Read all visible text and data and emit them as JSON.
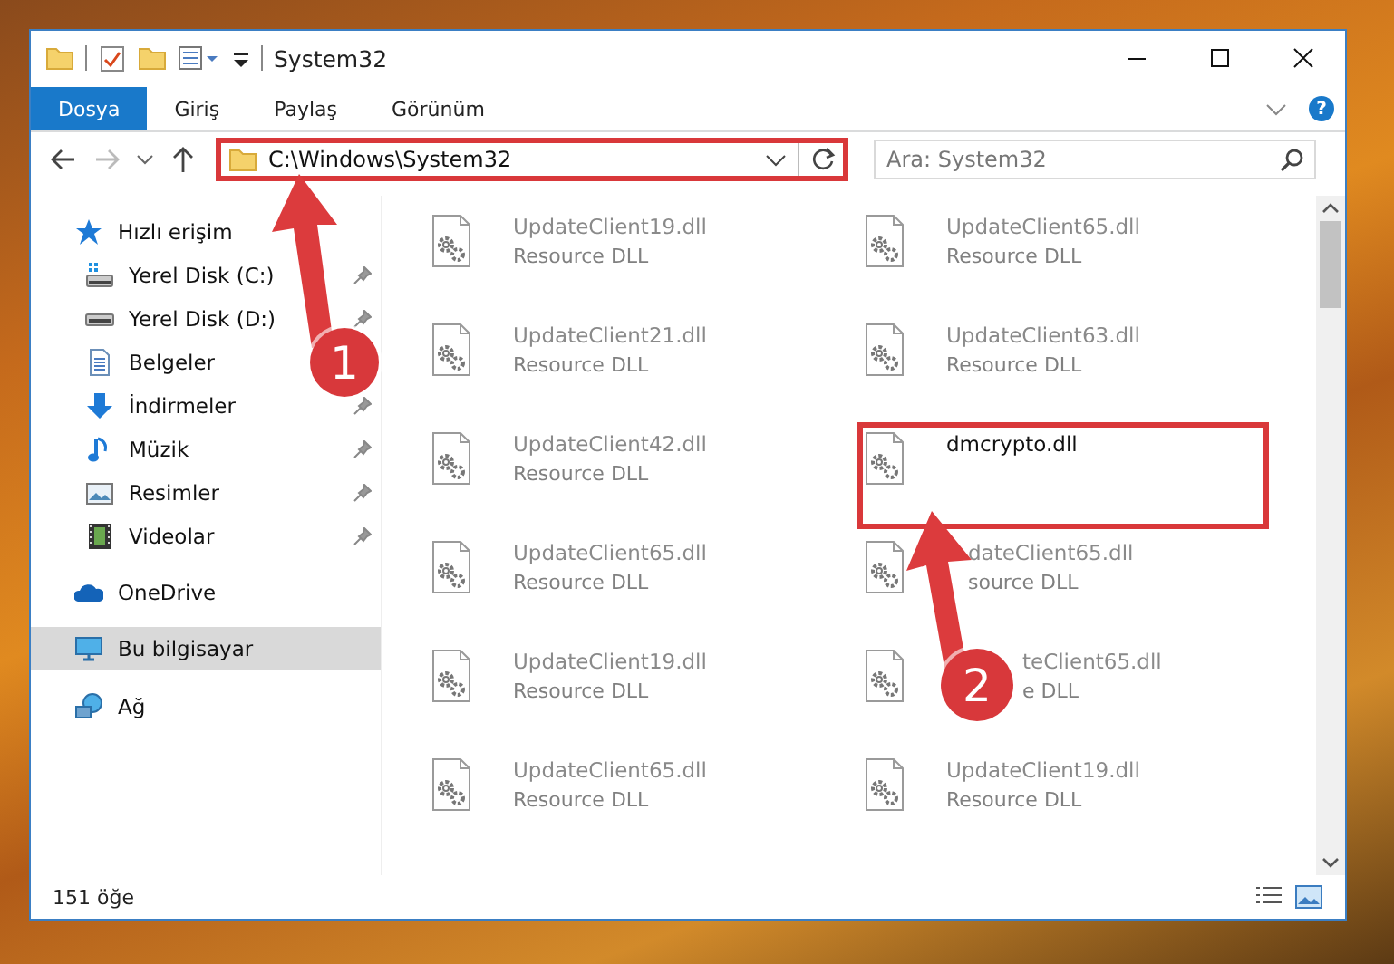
{
  "window": {
    "title": "System32"
  },
  "ribbon": {
    "tabs": [
      {
        "label": "Dosya",
        "selected": true
      },
      {
        "label": "Giriş",
        "selected": false
      },
      {
        "label": "Paylaş",
        "selected": false
      },
      {
        "label": "Görünüm",
        "selected": false
      }
    ],
    "help_label": "?"
  },
  "address_bar": {
    "path": "C:\\Windows\\System32"
  },
  "search": {
    "placeholder": "Ara: System32"
  },
  "sidebar": {
    "items": [
      {
        "label": "Hızlı erişim",
        "kind": "quick",
        "selected": false,
        "children": [
          {
            "label": "Yerel Disk (C:)",
            "kind": "drive-c",
            "pinned": true,
            "selected": false
          },
          {
            "label": "Yerel Disk (D:)",
            "kind": "drive",
            "pinned": true,
            "selected": false
          },
          {
            "label": "Belgeler",
            "kind": "documents",
            "selected": false
          },
          {
            "label": "İndirmeler",
            "kind": "downloads",
            "pinned": true,
            "selected": false
          },
          {
            "label": "Müzik",
            "kind": "music",
            "pinned": true,
            "selected": false
          },
          {
            "label": "Resimler",
            "kind": "pictures",
            "pinned": true,
            "selected": false
          },
          {
            "label": "Videolar",
            "kind": "videos",
            "pinned": true,
            "selected": false
          }
        ]
      },
      {
        "label": "OneDrive",
        "kind": "onedrive",
        "selected": false
      },
      {
        "label": "Bu bilgisayar",
        "kind": "pc",
        "selected": true
      },
      {
        "label": "Ağ",
        "kind": "network",
        "selected": false
      }
    ]
  },
  "files": [
    {
      "name": "UpdateClient19.dll",
      "type": "Resource DLL",
      "faded": true,
      "kind": "plain"
    },
    {
      "name": "UpdateClient65.dll",
      "type": "Resource DLL",
      "faded": true,
      "kind": "plain"
    },
    {
      "name": "UpdateClient21.dll",
      "type": "Resource DLL",
      "faded": true,
      "kind": "plain"
    },
    {
      "name": "UpdateClient63.dll",
      "type": "Resource DLL",
      "faded": true,
      "kind": "plain"
    },
    {
      "name": "UpdateClient42.dll",
      "type": "Resource DLL",
      "faded": true,
      "kind": "plain"
    },
    {
      "name": "dmcrypto.dll",
      "faded": false,
      "kind": "plain"
    },
    {
      "name": "UpdateClient65.dll",
      "type": "Resource DLL",
      "faded": true,
      "kind": "plain"
    },
    {
      "name": "dateClient65.dll",
      "type": "source DLL",
      "faded": true,
      "kind": "under-arrow"
    },
    {
      "name": "UpdateClient19.dll",
      "type": "Resource DLL",
      "faded": true,
      "kind": "plain"
    },
    {
      "name": "teClient65.dll",
      "type": "e DLL",
      "faded": true,
      "kind": "under-badge"
    },
    {
      "name": "UpdateClient65.dll",
      "type": "Resource DLL",
      "faded": true,
      "kind": "plain"
    },
    {
      "name": "UpdateClient19.dll",
      "type": "Resource DLL",
      "faded": true,
      "kind": "plain"
    }
  ],
  "status_bar": {
    "item_count": "151 öğe"
  },
  "annotations": [
    {
      "label": "1"
    },
    {
      "label": "2"
    }
  ]
}
